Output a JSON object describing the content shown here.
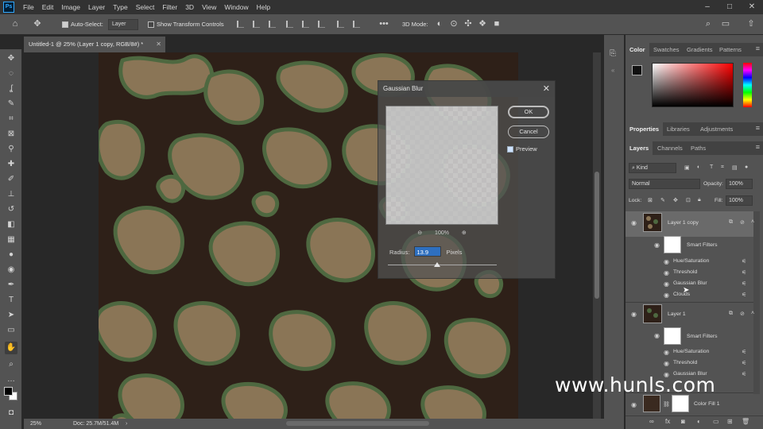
{
  "app": {
    "logo": "Ps"
  },
  "menu": [
    "File",
    "Edit",
    "Image",
    "Layer",
    "Type",
    "Select",
    "Filter",
    "3D",
    "View",
    "Window",
    "Help"
  ],
  "options": {
    "auto_select_label": "Auto-Select:",
    "auto_select_value": "Layer",
    "transform_label": "Show Transform Controls",
    "mode_3d_label": "3D Mode:"
  },
  "document": {
    "tab_title": "Untitled-1 @ 25% (Layer 1 copy, RGB/8#) *",
    "zoom": "25%",
    "doc_size": "Doc: 25.7M/51.4M"
  },
  "gaussian_blur": {
    "title": "Gaussian Blur",
    "ok_label": "OK",
    "cancel_label": "Cancel",
    "preview_label": "Preview",
    "preview_checked": true,
    "zoom_label": "100%",
    "radius_label": "Radius:",
    "radius_value": "13.9",
    "radius_unit": "Pixels",
    "slider_fraction": 0.45
  },
  "color_panel": {
    "tabs": [
      "Color",
      "Swatches",
      "Gradients",
      "Patterns"
    ],
    "foreground": "#111111",
    "background": "#ffffff"
  },
  "props_panel": {
    "tabs": [
      "Properties",
      "Libraries",
      "Adjustments"
    ]
  },
  "layers_panel": {
    "tabs": [
      "Layers",
      "Channels",
      "Paths"
    ],
    "filter_kind": "Kind",
    "blend_mode": "Normal",
    "opacity_label": "Opacity:",
    "opacity_value": "100%",
    "lock_label": "Lock:",
    "fill_label": "Fill:",
    "fill_value": "100%",
    "layer1_copy": {
      "name": "Layer 1 copy",
      "smart_filters_label": "Smart Filters",
      "filters": [
        "Hue/Saturation",
        "Threshold",
        "Gaussian Blur",
        "Clouds"
      ]
    },
    "layer1": {
      "name": "Layer 1",
      "smart_filters_label": "Smart Filters",
      "filters": [
        "Hue/Saturation",
        "Threshold",
        "Gaussian Blur"
      ]
    },
    "fill_layer": {
      "name": "Color Fill 1"
    }
  },
  "watermark": "www.hunls.com",
  "colors": {
    "camo_dark": "#2e2018",
    "camo_tan": "#8a7556",
    "camo_green": "#4e6840",
    "ui_panel": "#535353"
  }
}
